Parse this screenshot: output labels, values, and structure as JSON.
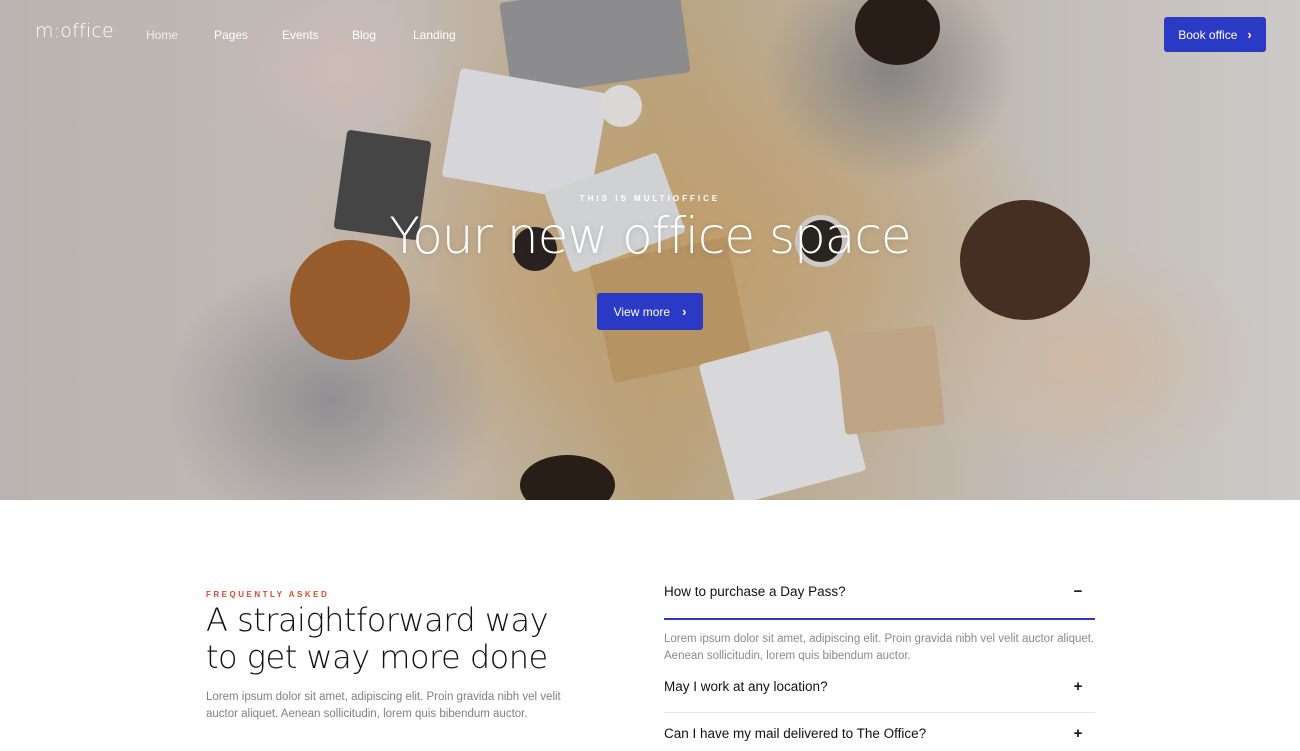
{
  "nav": {
    "logo": "m:office",
    "links": [
      {
        "label": "Home"
      },
      {
        "label": "Pages"
      },
      {
        "label": "Events"
      },
      {
        "label": "Blog"
      },
      {
        "label": "Landing"
      }
    ],
    "cta_label": "Book office",
    "cta_icon": "chevron-right-icon"
  },
  "hero": {
    "eyebrow": "THIS IS MULTIOFFICE",
    "title": "Your new office space",
    "button_label": "View more",
    "button_icon": "chevron-right-icon",
    "accent_color": "#2b3ac4"
  },
  "faq": {
    "eyebrow": "FREQUENTLY ASKED",
    "eyebrow_color": "#e0452d",
    "title": "A straightforward way to get way more done",
    "description": "Lorem ipsum dolor sit amet, adipiscing elit. Proin gravida nibh vel velit auctor aliquet. Aenean sollicitudin, lorem quis bibendum auctor.",
    "items": [
      {
        "question": "How to purchase a Day Pass?",
        "toggle": "−",
        "expanded": true,
        "answer": "Lorem ipsum dolor sit amet, adipiscing elit. Proin gravida nibh vel velit auctor aliquet. Aenean sollicitudin, lorem quis bibendum auctor."
      },
      {
        "question": "May I work at any location?",
        "toggle": "+",
        "expanded": false
      },
      {
        "question": "Can I have my mail delivered to The Office?",
        "toggle": "+",
        "expanded": false
      }
    ]
  }
}
